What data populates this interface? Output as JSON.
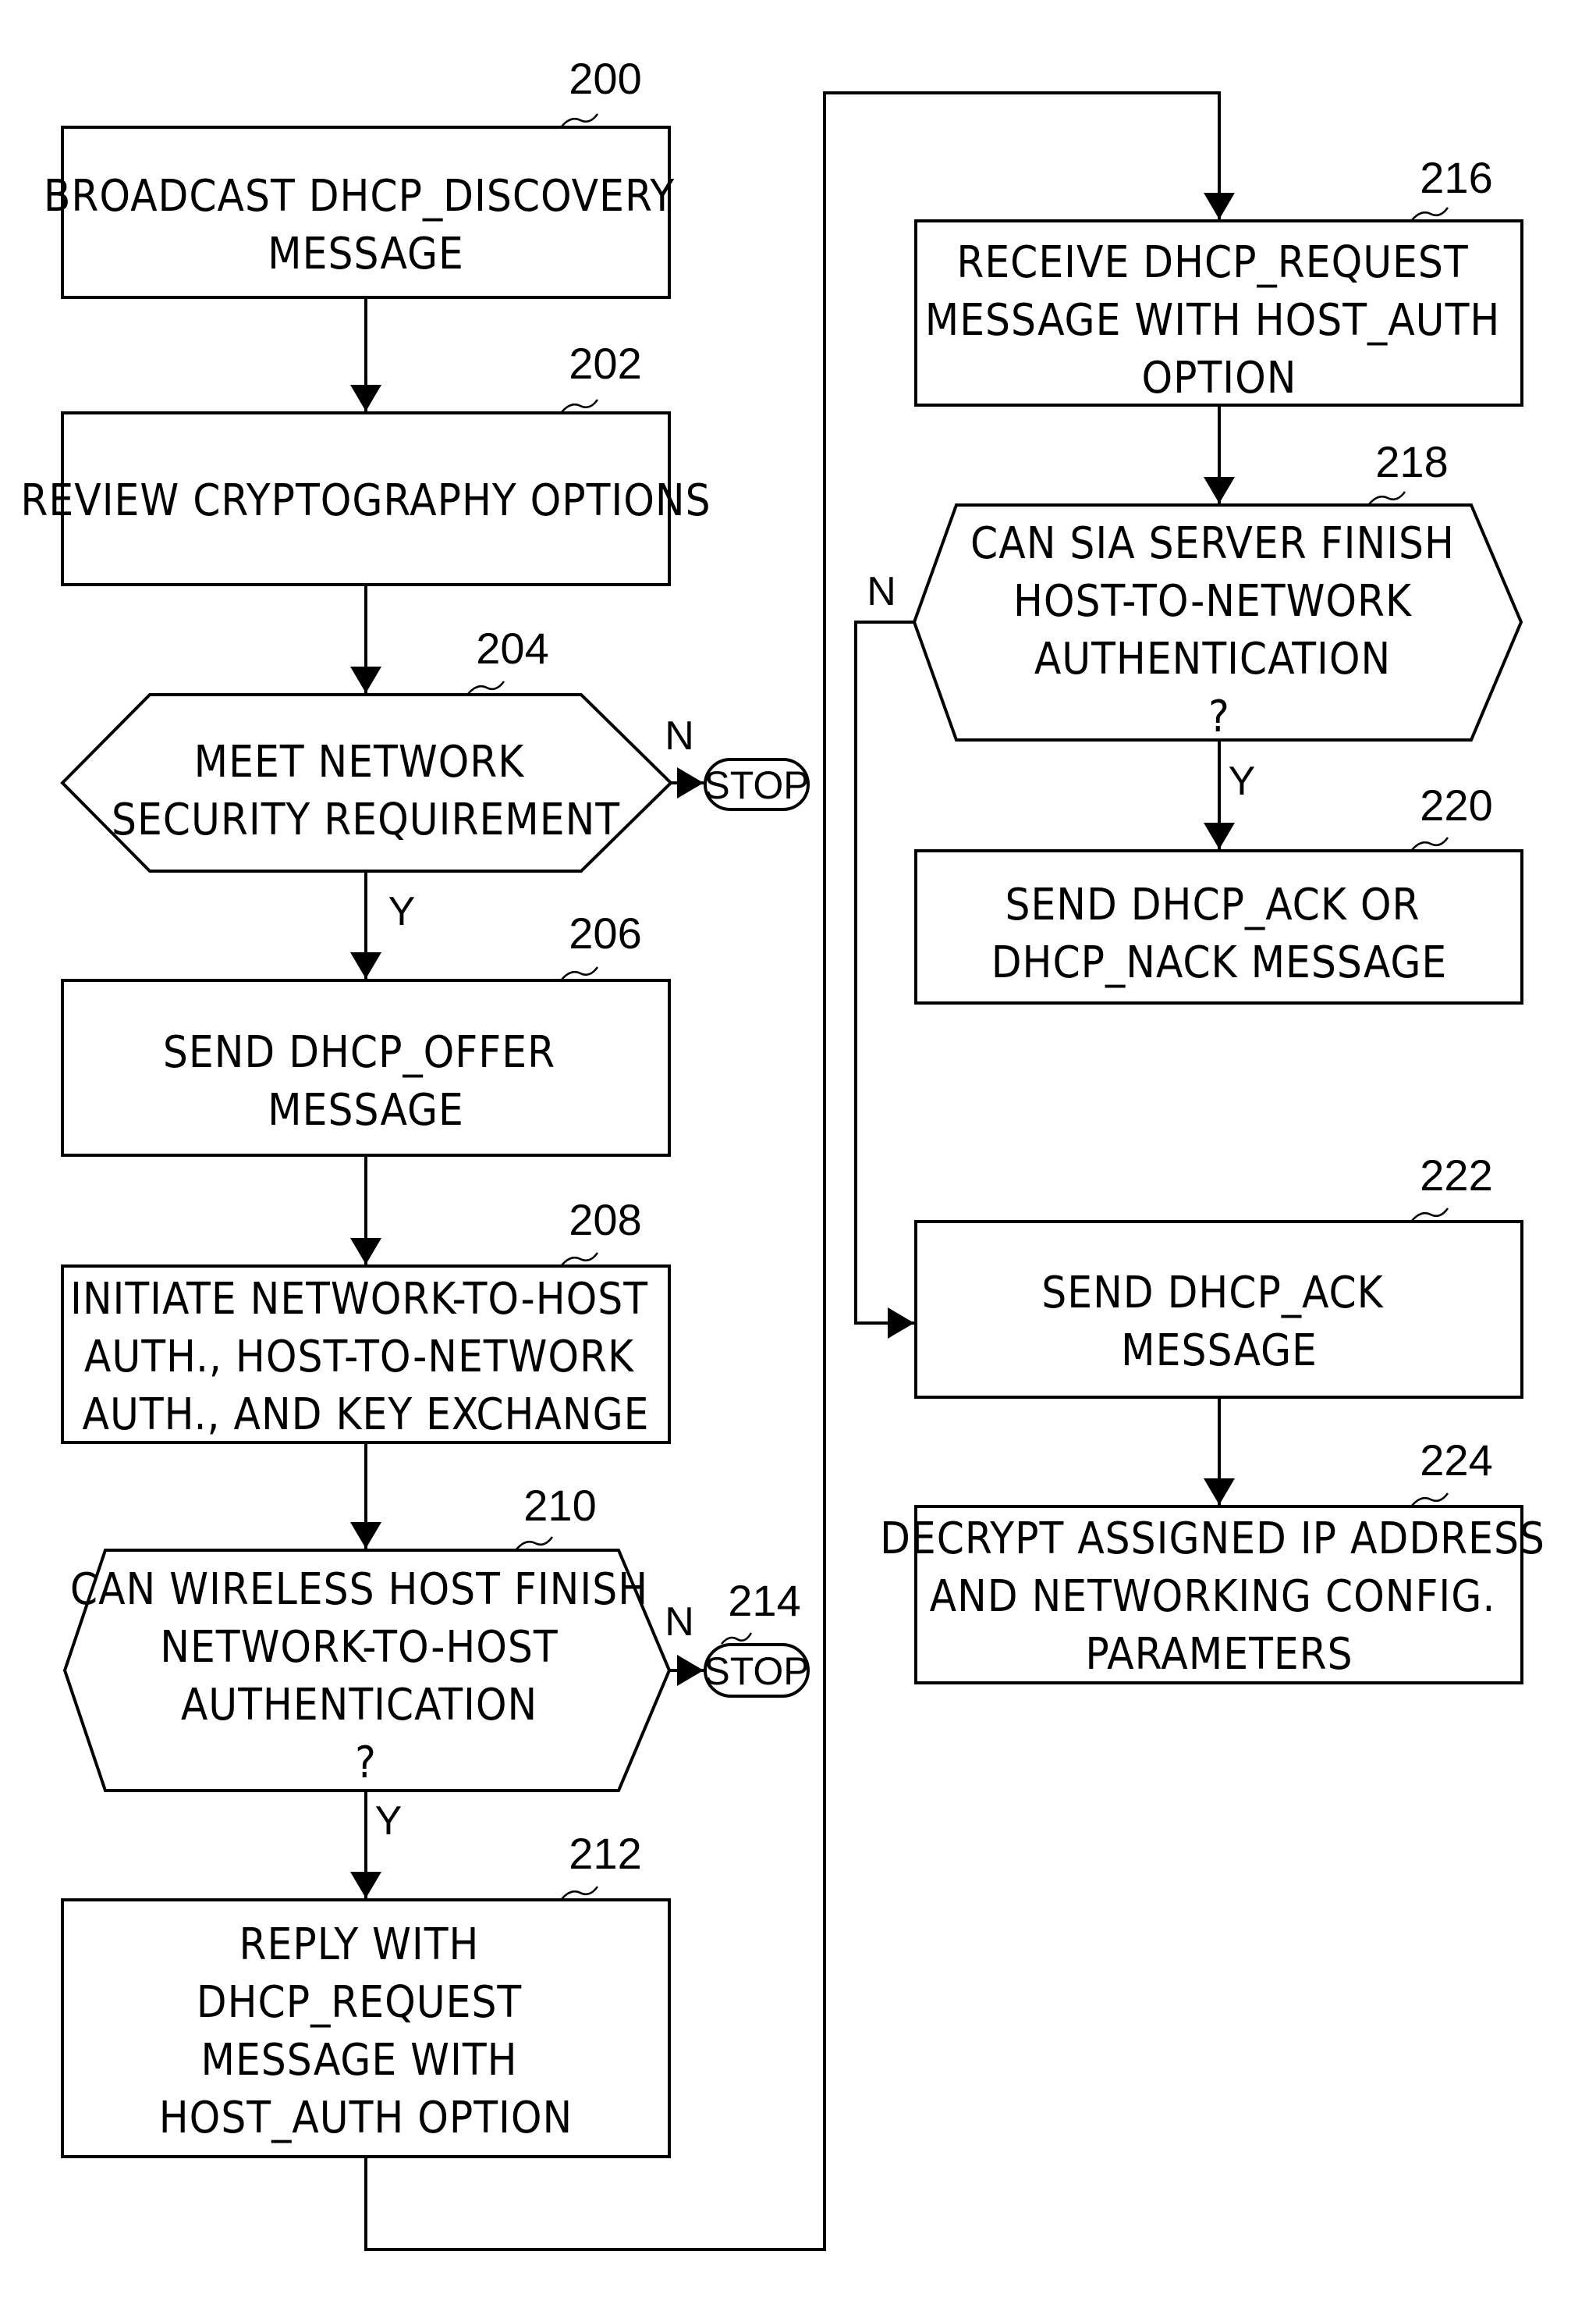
{
  "nodes": {
    "n200": {
      "ref": "200",
      "lines": [
        "BROADCAST DHCP_DISCOVERY",
        "MESSAGE"
      ]
    },
    "n202": {
      "ref": "202",
      "lines": [
        "REVIEW CRYPTOGRAPHY OPTIONS"
      ]
    },
    "n204": {
      "ref": "204",
      "lines": [
        "MEET NETWORK",
        "SECURITY REQUIREMENT"
      ]
    },
    "n206": {
      "ref": "206",
      "lines": [
        "SEND DHCP_OFFER",
        "MESSAGE"
      ]
    },
    "n208": {
      "ref": "208",
      "lines": [
        "INITIATE NETWORK-TO-HOST",
        "AUTH., HOST-TO-NETWORK",
        "AUTH., AND KEY EXCHANGE"
      ]
    },
    "n210": {
      "ref": "210",
      "lines": [
        "CAN WIRELESS HOST FINISH",
        "NETWORK-TO-HOST",
        "AUTHENTICATION",
        "?"
      ]
    },
    "n212": {
      "ref": "212",
      "lines": [
        "REPLY WITH",
        "DHCP_REQUEST",
        "MESSAGE WITH",
        "HOST_AUTH OPTION"
      ]
    },
    "n214": {
      "ref": "214",
      "label": "STOP"
    },
    "stop204": {
      "label": "STOP"
    },
    "n216": {
      "ref": "216",
      "lines": [
        "RECEIVE DHCP_REQUEST",
        "MESSAGE WITH HOST_AUTH",
        "OPTION"
      ]
    },
    "n218": {
      "ref": "218",
      "lines": [
        "CAN SIA SERVER FINISH",
        "HOST-TO-NETWORK",
        "AUTHENTICATION",
        "?"
      ]
    },
    "n220": {
      "ref": "220",
      "lines": [
        "SEND DHCP_ACK OR",
        "DHCP_NACK MESSAGE"
      ]
    },
    "n222": {
      "ref": "222",
      "lines": [
        "SEND DHCP_ACK",
        "MESSAGE"
      ]
    },
    "n224": {
      "ref": "224",
      "lines": [
        "DECRYPT ASSIGNED IP ADDRESS",
        "AND NETWORKING CONFIG.",
        "PARAMETERS"
      ]
    }
  },
  "edge_labels": {
    "yes": "Y",
    "no": "N"
  }
}
